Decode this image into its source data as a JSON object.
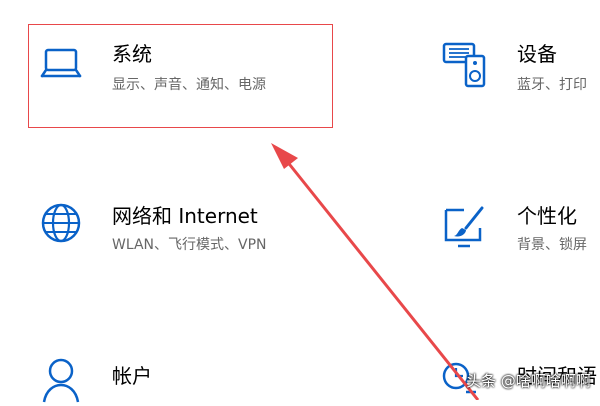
{
  "settings_tiles": [
    {
      "title": "系统",
      "subtitle": "显示、声音、通知、电源",
      "icon": "laptop-icon"
    },
    {
      "title": "设备",
      "subtitle": "蓝牙、打印",
      "icon": "devices-icon"
    },
    {
      "title": "网络和 Internet",
      "subtitle": "WLAN、飞行模式、VPN",
      "icon": "globe-icon"
    },
    {
      "title": "个性化",
      "subtitle": "背景、锁屏",
      "icon": "personalization-icon"
    },
    {
      "title": "帐户",
      "subtitle": "",
      "icon": "person-icon"
    },
    {
      "title": "时间和语",
      "subtitle": "",
      "icon": "time-language-icon"
    }
  ],
  "watermark": "头条 @啥啊啥啊啊",
  "colors": {
    "accent": "#0a62c8",
    "annotation": "#e8484a",
    "subtitle": "#666666"
  }
}
